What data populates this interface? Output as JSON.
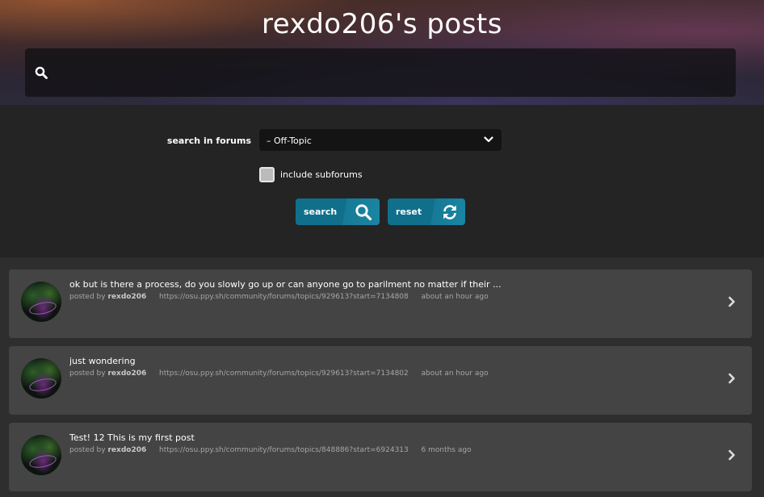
{
  "header": {
    "title": "rexdo206's posts",
    "search_value": ""
  },
  "filters": {
    "forums_label": "search in forums",
    "forum_selected": "– Off-Topic",
    "subforums_label": "include subforums",
    "subforums_checked": false,
    "search_button": "search",
    "reset_button": "reset"
  },
  "posts": [
    {
      "text": "ok but is there a process, do you slowly go up or can anyone go to parilment no matter if their ...",
      "posted_by": "posted by",
      "author": "rexdo206",
      "url": "https://osu.ppy.sh/community/forums/topics/929613?start=7134808",
      "time": "about an hour ago"
    },
    {
      "text": "just wondering",
      "posted_by": "posted by",
      "author": "rexdo206",
      "url": "https://osu.ppy.sh/community/forums/topics/929613?start=7134802",
      "time": "about an hour ago"
    },
    {
      "text": "Test! 12 This is my first post",
      "posted_by": "posted by",
      "author": "rexdo206",
      "url": "https://osu.ppy.sh/community/forums/topics/848886?start=6924313",
      "time": "6 months ago"
    }
  ],
  "icons": {
    "search": "search-icon",
    "dropdown": "chevron-down-icon",
    "reset": "refresh-icon",
    "post_open": "chevron-right-icon"
  },
  "colors": {
    "accent": "#10708c",
    "post_bg": "#444444",
    "panel_bg": "#242424"
  }
}
